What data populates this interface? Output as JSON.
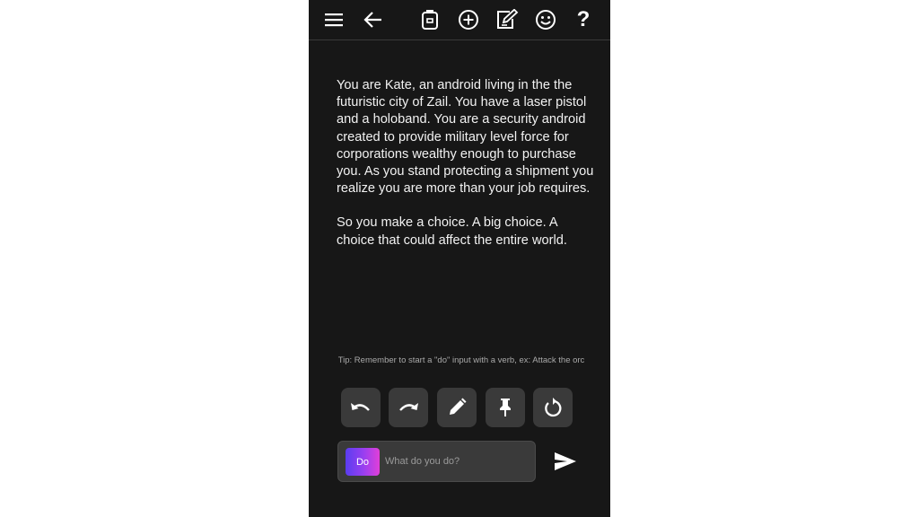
{
  "toolbar": {
    "icons": [
      "menu-icon",
      "back-arrow-icon",
      "backpack-icon",
      "add-circle-icon",
      "edit-note-icon",
      "smiley-icon",
      "help-icon"
    ],
    "help_label": "?"
  },
  "story": {
    "paragraphs": [
      "You are Kate, an android living in the the futuristic city of Zail. You have a laser pistol and a holoband. You are a security android created to provide military level force for corporations wealthy enough to purchase you. As you stand protecting a shipment you realize you are more than your job requires.",
      "So you make a choice. A big choice. A choice that could affect the entire world."
    ]
  },
  "tip": "Tip: Remember to start a \"do\" input with a verb, ex: Attack the orc",
  "actions": [
    "undo-icon",
    "redo-icon",
    "pencil-icon",
    "pin-icon",
    "retry-icon"
  ],
  "input": {
    "mode_label": "Do",
    "placeholder": "What do you do?",
    "value": ""
  },
  "colors": {
    "background": "#171717",
    "button": "#3a3a3a",
    "text": "#f2f2f2",
    "tip_text": "#a9a9a9",
    "do_gradient_start": "#5a3df0",
    "do_gradient_end": "#e13fd8"
  }
}
